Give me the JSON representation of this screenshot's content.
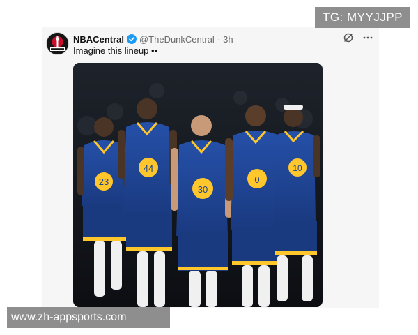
{
  "watermarks": {
    "top_right": "TG: MYYJJPP",
    "bottom_left": "www.zh-appsports.com"
  },
  "tweet": {
    "display_name": "NBACentral",
    "handle": "@TheDunkCentral",
    "separator": "·",
    "time": "3h",
    "text": "Imagine this lineup ••",
    "avatar_icon": "nba-central-logo-icon",
    "verified_icon": "verified-badge-icon",
    "action_icons": [
      "grok-icon",
      "more-options-icon"
    ],
    "media": {
      "description_icon": "warriors-players-photo",
      "jersey_numbers": [
        "23",
        "44",
        "30",
        "0",
        "10"
      ]
    }
  },
  "colors": {
    "card_bg": "#f6f6f6",
    "verified_blue": "#1d9bf0",
    "warriors_blue": "#1d428a",
    "warriors_gold": "#ffc72c",
    "watermark_bg": "#8e8e8e"
  }
}
